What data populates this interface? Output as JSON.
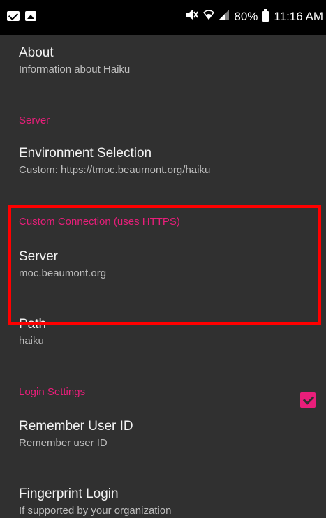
{
  "status_bar": {
    "left_icons": [
      "mail-icon",
      "image-icon"
    ],
    "right_icons": [
      "mute-icon",
      "wifi-icon",
      "signal-icon",
      "battery-icon"
    ],
    "battery": "80%",
    "time": "11:16 AM"
  },
  "about": {
    "title": "About",
    "subtitle": "Information about Haiku"
  },
  "sections": {
    "server": "Server",
    "custom_connection": "Custom Connection (uses HTTPS)",
    "login_settings": "Login Settings"
  },
  "environment": {
    "title": "Environment Selection",
    "subtitle": "Custom: https://tmoc.beaumont.org/haiku"
  },
  "server_item": {
    "title": "Server",
    "subtitle": "moc.beaumont.org"
  },
  "path_item": {
    "title": "Path",
    "subtitle": "haiku"
  },
  "remember_user": {
    "title": "Remember User ID",
    "subtitle": "Remember user ID",
    "checked": true
  },
  "fingerprint": {
    "title": "Fingerprint Login",
    "subtitle": "If supported by your organization"
  },
  "colors": {
    "accent": "#e91e7a",
    "background": "#303030",
    "highlight": "#ff0000"
  }
}
